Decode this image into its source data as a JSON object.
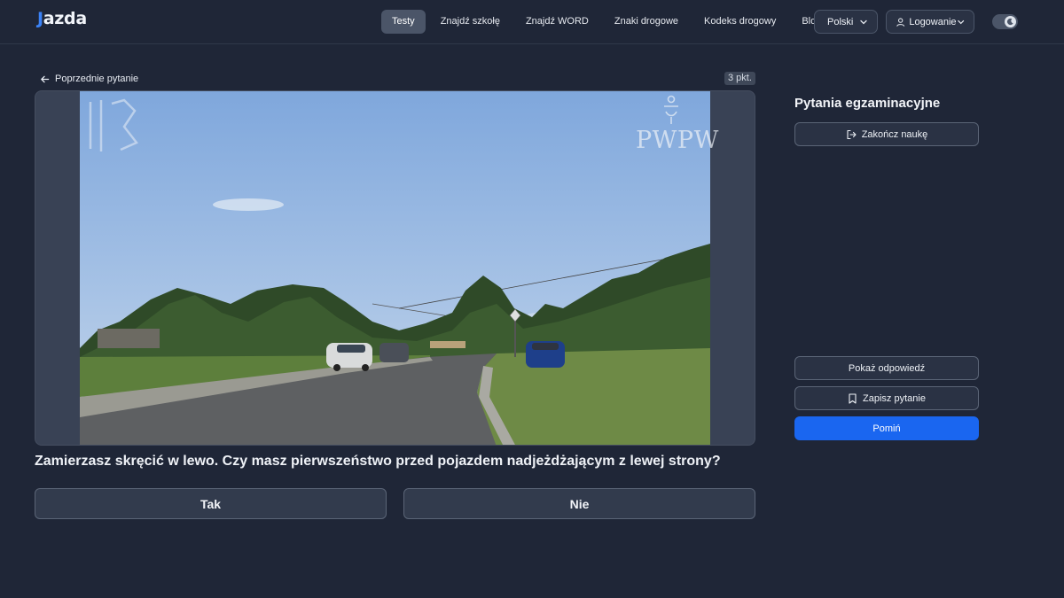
{
  "brand": {
    "logo_text": "jazda",
    "accent": "#1a66f0"
  },
  "nav": {
    "items": [
      "Testy",
      "Znajdź szkołę",
      "Znajdź WORD",
      "Znaki drogowe",
      "Kodeks drogowy",
      "Blog"
    ],
    "active": "Testy"
  },
  "language": {
    "label": "Polski",
    "icon": "chevron-down-icon"
  },
  "login": {
    "label": "Logowanie",
    "icon": "user-icon"
  },
  "theme_toggle": {
    "icon": "moon-icon"
  },
  "question_nav": {
    "previous_label": "Poprzednie pytanie",
    "points": "3 pkt."
  },
  "media": {
    "watermark_right": "PWPW"
  },
  "question": {
    "text": "Zamierzasz skręcić w lewo. Czy masz pierwszeństwo przed pojazdem nadjeżdżającym z lewej strony?",
    "answers": [
      "Tak",
      "Nie"
    ]
  },
  "sidebar": {
    "title": "Pytania egzaminacyjne",
    "end_label": "Zakończ naukę",
    "show_answer_label": "Pokaż odpowiedź",
    "save_label": "Zapisz pytanie",
    "skip_label": "Pomiń"
  }
}
